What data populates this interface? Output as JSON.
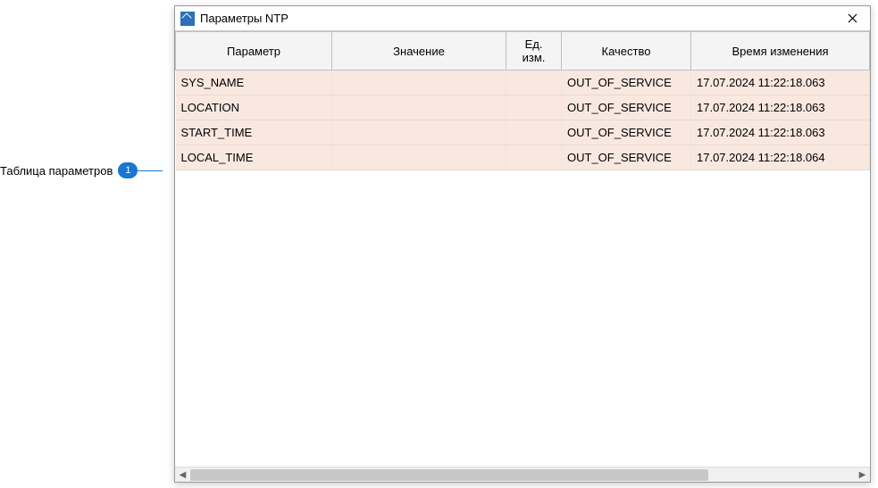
{
  "annotation": {
    "label": "Таблица параметров",
    "badge": "1"
  },
  "window": {
    "title": "Параметры NTP"
  },
  "table": {
    "headers": {
      "param": "Параметр",
      "value": "Значение",
      "unit": "Ед. изм.",
      "quality": "Качество",
      "time": "Время изменения"
    },
    "rows": [
      {
        "param": "SYS_NAME",
        "value": "",
        "unit": "",
        "quality": "OUT_OF_SERVICE",
        "time": "17.07.2024 11:22:18.063"
      },
      {
        "param": "LOCATION",
        "value": "",
        "unit": "",
        "quality": "OUT_OF_SERVICE",
        "time": "17.07.2024 11:22:18.063"
      },
      {
        "param": "START_TIME",
        "value": "",
        "unit": "",
        "quality": "OUT_OF_SERVICE",
        "time": "17.07.2024 11:22:18.063"
      },
      {
        "param": "LOCAL_TIME",
        "value": "",
        "unit": "",
        "quality": "OUT_OF_SERVICE",
        "time": "17.07.2024 11:22:18.064"
      }
    ]
  }
}
